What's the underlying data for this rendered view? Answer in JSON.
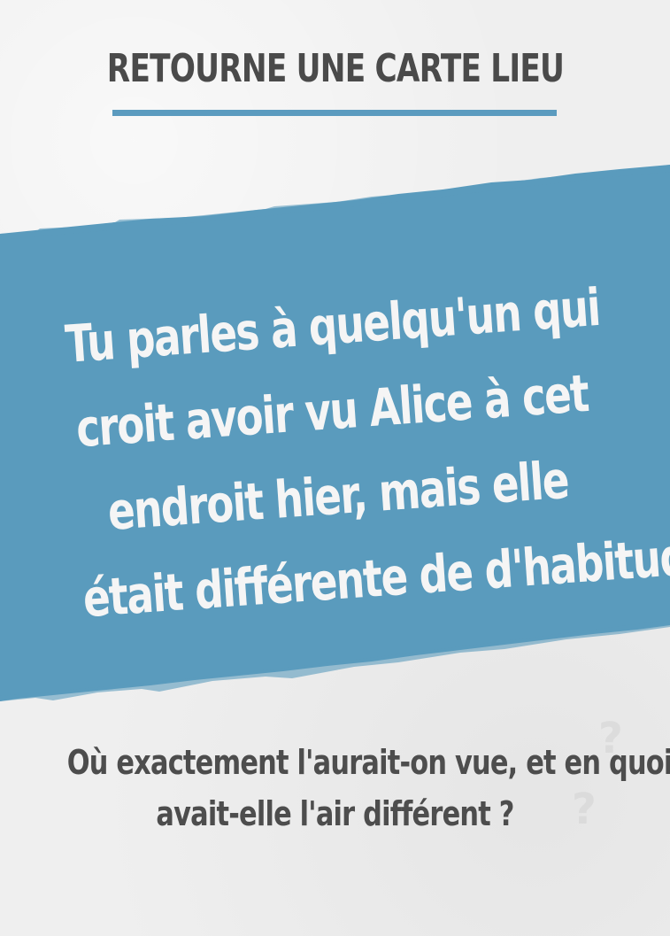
{
  "card": {
    "header": "RETOURNE UNE CARTE LIEU",
    "prompt_lines": [
      "Tu parles à quelqu'un qui",
      "croit avoir vu Alice à cet",
      "endroit hier, mais elle",
      "était différente de d'habitude."
    ],
    "question_lines": [
      "Où exactement l'aurait-on vue, et en quoi",
      "avait-elle l'air différent ?"
    ]
  },
  "colors": {
    "background": "#efefef",
    "banner": "#5a9bbd",
    "header_text": "#4a4a4a",
    "underline": "#5b9bbf",
    "card_text": "#f5f5f5",
    "question_text": "#4d4d4d"
  }
}
